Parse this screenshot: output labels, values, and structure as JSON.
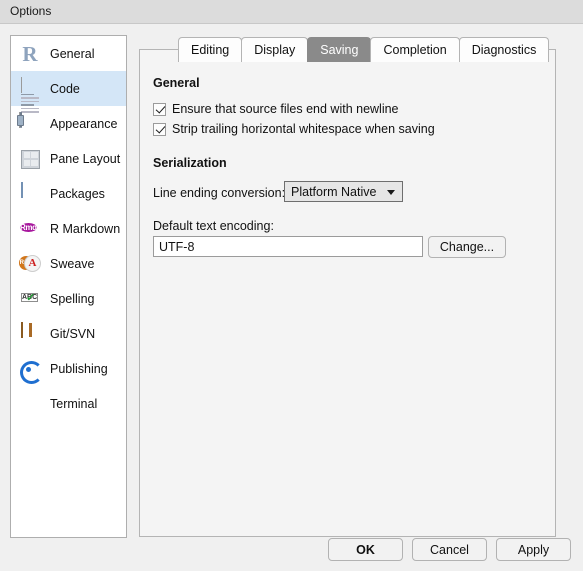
{
  "window": {
    "title": "Options"
  },
  "sidebar": {
    "items": [
      {
        "label": "General",
        "icon": "r-logo-icon",
        "selected": false
      },
      {
        "label": "Code",
        "icon": "document-icon",
        "selected": true
      },
      {
        "label": "Appearance",
        "icon": "paint-can-icon",
        "selected": false
      },
      {
        "label": "Pane Layout",
        "icon": "panes-grid-icon",
        "selected": false
      },
      {
        "label": "Packages",
        "icon": "package-box-icon",
        "selected": false
      },
      {
        "label": "R Markdown",
        "icon": "rmd-circle-icon",
        "selected": false
      },
      {
        "label": "Sweave",
        "icon": "sweave-pdf-icon",
        "selected": false
      },
      {
        "label": "Spelling",
        "icon": "abc-check-icon",
        "selected": false
      },
      {
        "label": "Git/SVN",
        "icon": "open-box-icon",
        "selected": false
      },
      {
        "label": "Publishing",
        "icon": "publish-ring-icon",
        "selected": false
      },
      {
        "label": "Terminal",
        "icon": "terminal-icon",
        "selected": false
      }
    ]
  },
  "tabs": [
    {
      "label": "Editing",
      "active": false
    },
    {
      "label": "Display",
      "active": false
    },
    {
      "label": "Saving",
      "active": true
    },
    {
      "label": "Completion",
      "active": false
    },
    {
      "label": "Diagnostics",
      "active": false
    }
  ],
  "panel": {
    "general": {
      "heading": "General",
      "checkboxes": [
        {
          "label": "Ensure that source files end with newline",
          "checked": true
        },
        {
          "label": "Strip trailing horizontal whitespace when saving",
          "checked": true
        }
      ]
    },
    "serialization": {
      "heading": "Serialization",
      "line_ending_label": "Line ending conversion:",
      "line_ending_value": "Platform Native",
      "line_ending_options": [
        "Platform Native"
      ],
      "encoding_label": "Default text encoding:",
      "encoding_value": "UTF-8",
      "change_button": "Change..."
    }
  },
  "footer": {
    "ok": "OK",
    "cancel": "Cancel",
    "apply": "Apply"
  },
  "colors": {
    "title_bar": "#dcdcdc",
    "selected_sidebar": "#d4e6f7",
    "active_tab": "#8a8a8a",
    "panel_bg": "#f4f4f4",
    "body_bg": "#f0f0f0"
  }
}
